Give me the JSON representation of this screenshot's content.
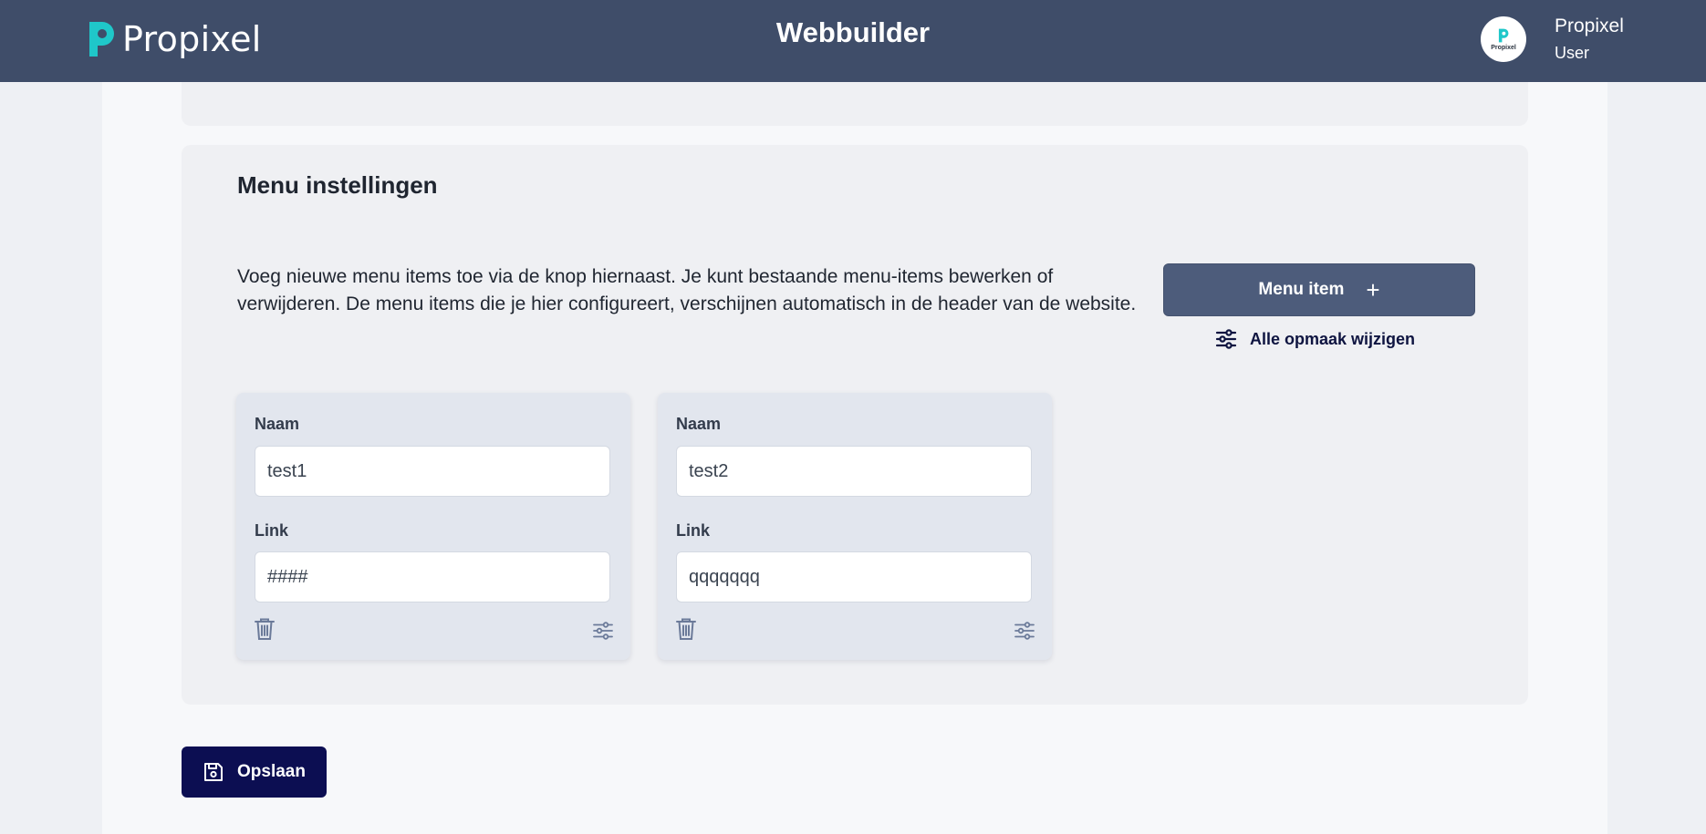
{
  "header": {
    "logo_text": "Propixel",
    "app_title": "Webbuilder",
    "user": {
      "name": "Propixel",
      "role": "User",
      "avatar_brand": "Propixel"
    }
  },
  "menu_settings": {
    "title": "Menu instellingen",
    "description": "Voeg nieuwe menu items toe via de knop hiernaast. Je kunt bestaande menu-items bewerken of verwijderen. De menu items die je hier configureert, verschijnen automatisch in de header van de website.",
    "add_button_label": "Menu item",
    "add_button_icon": "plus-icon",
    "style_all_label": "Alle opmaak wijzigen",
    "style_all_icon": "sliders-icon",
    "items": [
      {
        "name_label": "Naam",
        "name_value": "test1",
        "link_label": "Link",
        "link_value": "####"
      },
      {
        "name_label": "Naam",
        "name_value": "test2",
        "link_label": "Link",
        "link_value": "qqqqqqq"
      }
    ]
  },
  "save_button": {
    "label": "Opslaan",
    "icon": "floppy-disk-icon"
  },
  "colors": {
    "header_bg": "#3f4d69",
    "accent_teal": "#1fc7c9",
    "add_button_bg": "#4d5c7b",
    "save_button_bg": "#0c0e52",
    "link_text": "#0e1440"
  }
}
